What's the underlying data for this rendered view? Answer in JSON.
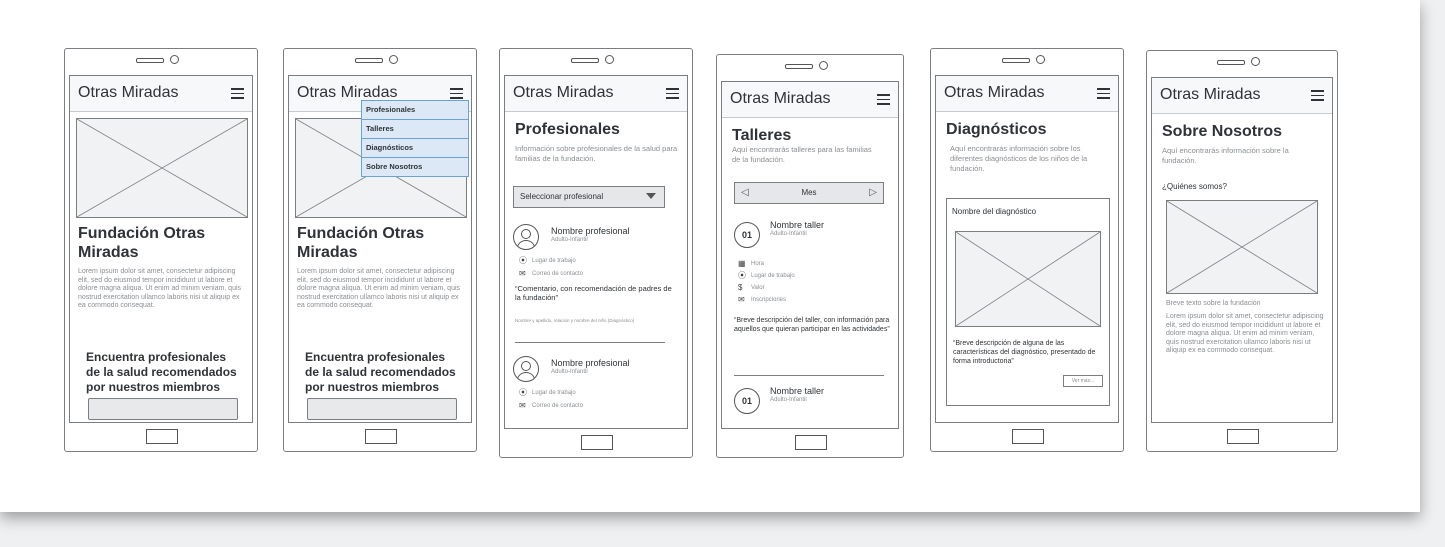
{
  "app_title": "Otras Miradas",
  "lorem": "Lorem ipsum dolor sit amet, consectetur adipiscing elit, sed do eiusmod tempor incididunt ut labore et dolore magna aliqua. Ut enim ad minim veniam, quis nostrud exercitation ullamco laboris nisi ut aliquip ex ea commodo consequat.",
  "screen1": {
    "heading": "Fundación Otras Miradas",
    "subheading": "Encuentra profesionales de la salud recomendados por nuestros miembros"
  },
  "screen2": {
    "menu": [
      "Profesionales",
      "Talleres",
      "Diagnósticos",
      "Sobre Nosotros"
    ]
  },
  "screen3": {
    "title": "Profesionales",
    "intro": "Información sobre profesionales de la salud para familias de la fundación.",
    "select_label": "Seleccionar profesional",
    "prof_name": "Nombre profesional",
    "prof_type": "Adulto-Infantil",
    "place": "Lugar de trabajo",
    "email": "Correo de contacto",
    "comment": "“Comentario, con recomendación de padres de la fundación”",
    "comment_note": "Nombre y apellido, relación y nombre del niño (Diagnóstico)"
  },
  "screen4": {
    "title": "Talleres",
    "intro": "Aquí encontrarás talleres para las familias de la fundación.",
    "month": "Mes",
    "num": "01",
    "taller_name": "Nombre taller",
    "taller_type": "Adulto-Infantil",
    "hora": "Hora",
    "place": "Lugar de trabajo",
    "valor": "Valor",
    "inscripciones": "Inscripciones",
    "desc": "“Breve descripción del taller, con información para aquellos que quieran participar en las actividades”"
  },
  "screen5": {
    "title": "Diagnósticos",
    "intro": "Aquí encontrarás información sobre los diferentes diagnósticos de los niños de la fundación.",
    "card_title": "Nombre del diagnóstico",
    "card_desc": "“Breve descripción de alguna de las características del diagnóstico, presentado de forma introductoria”",
    "more": "Ver más..."
  },
  "screen6": {
    "title": "Sobre Nosotros",
    "intro": "Aquí encontrarás información sobre la fundación.",
    "question": "¿Quiénes somos?",
    "caption": "Breve texto sobre la fundación"
  }
}
